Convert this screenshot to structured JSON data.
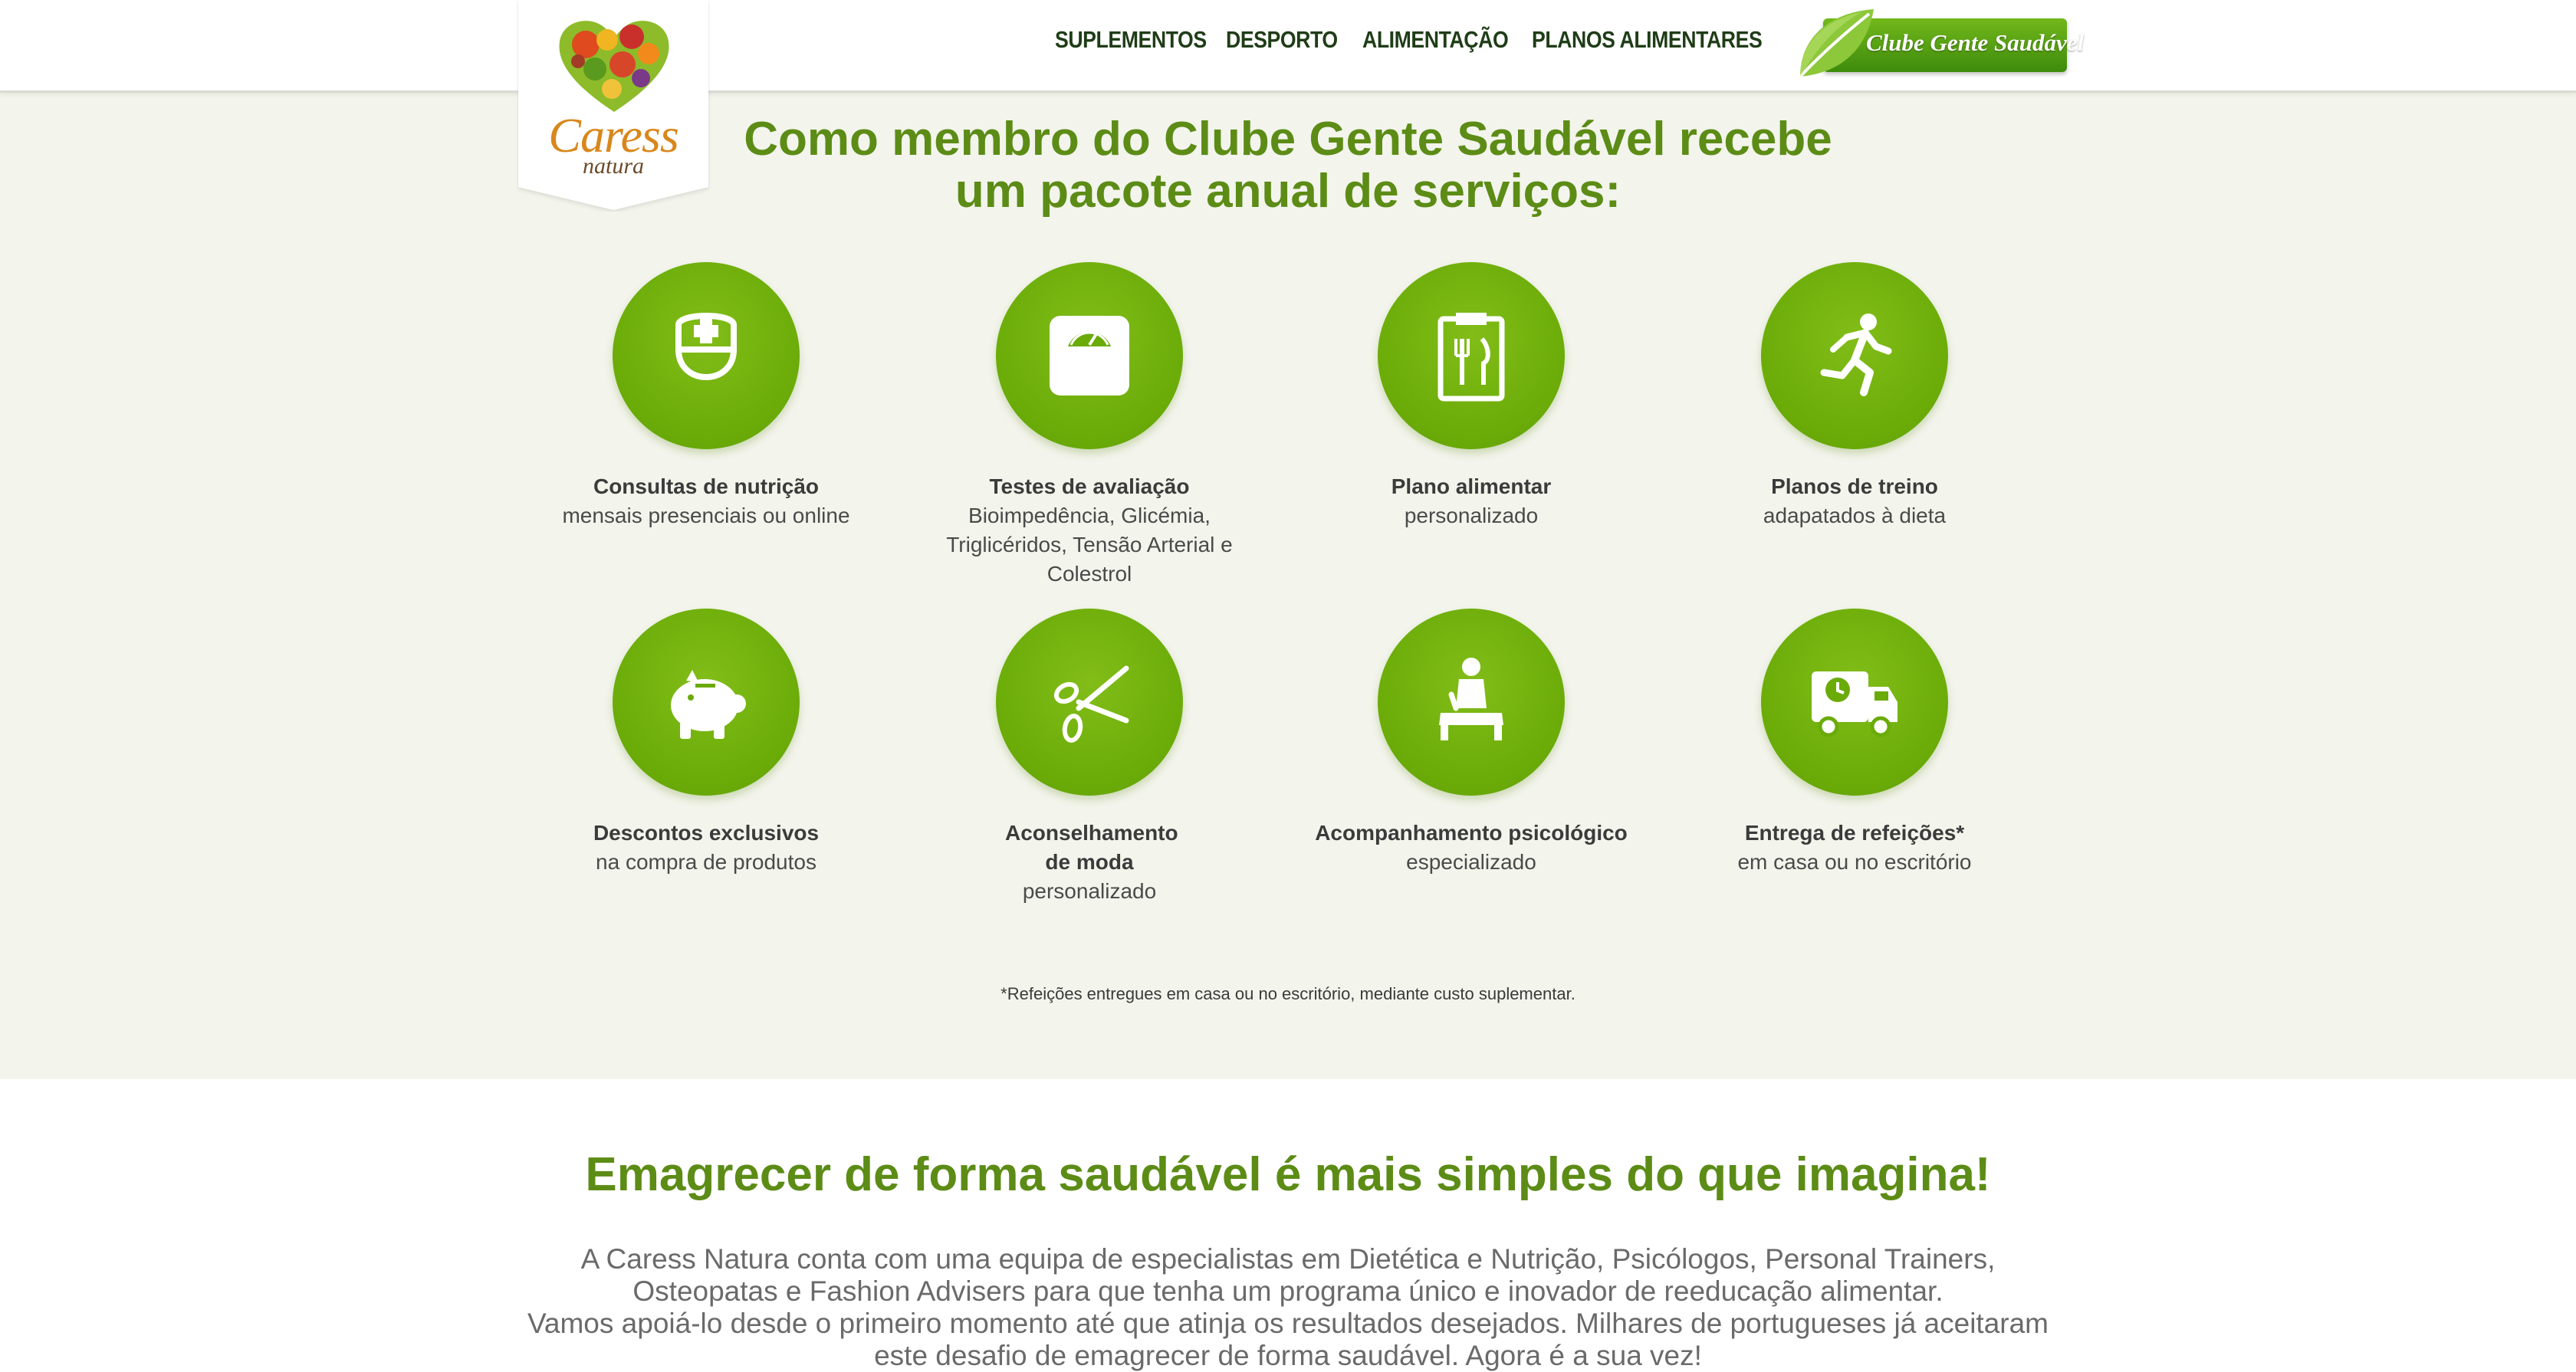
{
  "header": {
    "logo": {
      "name": "Caress",
      "subname": "natura"
    },
    "nav": [
      "SUPLEMENTOS",
      "DESPORTO",
      "ALIMENTAÇÃO",
      "PLANOS ALIMENTARES"
    ],
    "club_button": "Clube Gente Saudável"
  },
  "services_section": {
    "title_line1": "Como membro do Clube Gente Saudável recebe",
    "title_line2": "um pacote anual de serviços:",
    "items": [
      {
        "icon": "nurse-icon",
        "title": "Consultas de nutrição",
        "desc": "mensais presenciais ou online"
      },
      {
        "icon": "scale-icon",
        "title": "Testes de avaliação",
        "desc": "Bioimpedência, Glicémia, Triglicéridos, Tensão Arterial e Colestrol"
      },
      {
        "icon": "meal-plan-icon",
        "title": "Plano alimentar",
        "desc": "personalizado"
      },
      {
        "icon": "runner-icon",
        "title": "Planos de treino",
        "desc": "adapatados à dieta"
      },
      {
        "icon": "piggy-bank-icon",
        "title": "Descontos exclusivos",
        "desc": "na compra de produtos"
      },
      {
        "icon": "scissors-icon",
        "title": "Aconselhamento de moda",
        "desc": "personalizado"
      },
      {
        "icon": "therapy-icon",
        "title": "Acompanhamento psicológico",
        "desc": "especializado"
      },
      {
        "icon": "delivery-truck-icon",
        "title": "Entrega de refeições*",
        "desc": "em casa ou no escritório"
      }
    ],
    "footnote": "*Refeições entregues em casa ou no escritório, mediante custo suplementar."
  },
  "lower_section": {
    "title": "Emagrecer de forma saudável é mais simples do que imagina!",
    "paragraph1": "A Caress Natura conta com uma equipa de especialistas em Dietética e Nutrição, Psicólogos, Personal Trainers, Osteopatas e Fashion Advisers para que tenha um programa único e inovador de reeducação alimentar.",
    "paragraph2": "Vamos apoiá-lo desde o primeiro momento até que atinja os resultados desejados. Milhares de portugueses já aceitaram este desafio de emagrecer de forma saudável. Agora é a sua vez!"
  },
  "colors": {
    "brand_green": "#6aab08",
    "title_green": "#5c8c16",
    "section_bg": "#f3f4ec"
  }
}
